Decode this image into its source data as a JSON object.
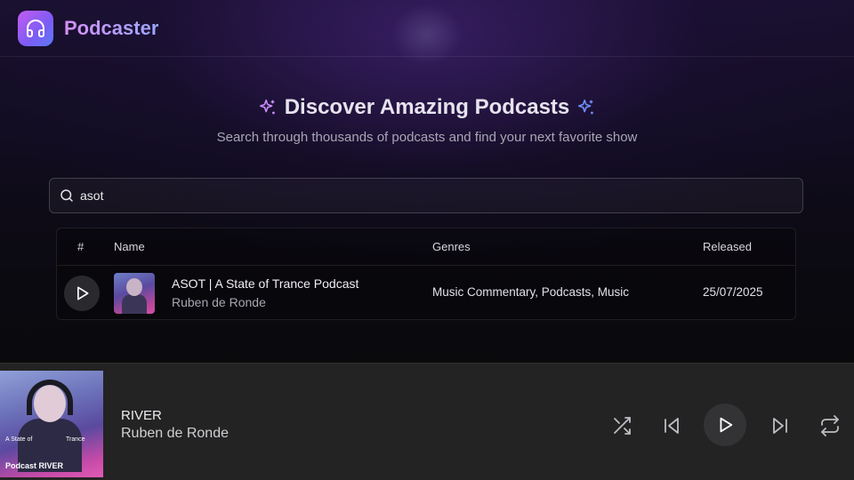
{
  "app": {
    "name": "Podcaster"
  },
  "hero": {
    "title": "Discover Amazing Podcasts",
    "subtitle": "Search through thousands of podcasts and find your next favorite show"
  },
  "search": {
    "value": "asot"
  },
  "table": {
    "columns": {
      "index": "#",
      "name": "Name",
      "genres": "Genres",
      "released": "Released"
    },
    "rows": [
      {
        "title": "ASOT | A State of Trance Podcast",
        "author": "Ruben de Ronde",
        "genres": "Music Commentary, Podcasts, Music",
        "released": "25/07/2025"
      }
    ]
  },
  "player": {
    "title": "RIVER",
    "artist": "Ruben de Ronde",
    "cover_text": {
      "left": "A State of",
      "right": "Trance",
      "bottom": "Podcast RIVER"
    }
  },
  "icons": {
    "logo": "headphones-icon",
    "sparkle": "sparkles-icon",
    "search": "search-icon",
    "play": "play-icon",
    "shuffle": "shuffle-icon",
    "previous": "skip-back-icon",
    "next": "skip-forward-icon",
    "repeat": "repeat-icon"
  },
  "colors": {
    "accent_start": "#c35cf0",
    "accent_end": "#5b7bf7",
    "sparkle_left": "#c68bf5",
    "sparkle_right": "#6f8cf7"
  }
}
